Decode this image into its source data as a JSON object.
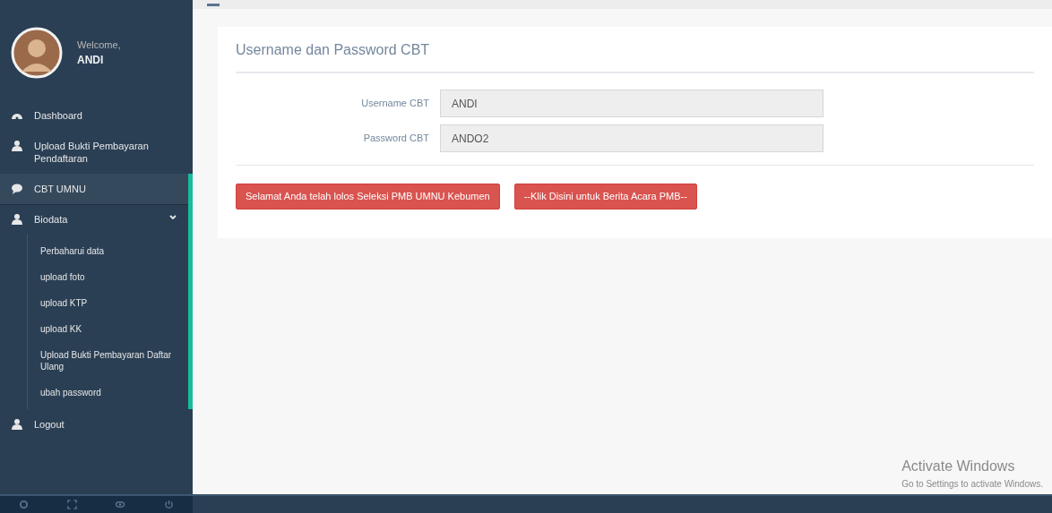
{
  "profile": {
    "greeting": "Welcome,",
    "name": "ANDI"
  },
  "menu": [
    {
      "kind": "link",
      "label": "Dashboard",
      "selected": false
    },
    {
      "kind": "link",
      "label": "Upload Bukti Pembayaran Pendaftaran",
      "selected": false
    },
    {
      "kind": "link",
      "label": "CBT UMNU",
      "selected": true
    },
    {
      "kind": "group",
      "label": "Biodata",
      "selected": false,
      "expanded": true,
      "children": [
        {
          "label": "Perbaharui data"
        },
        {
          "label": "upload foto"
        },
        {
          "label": "upload KTP"
        },
        {
          "label": "upload KK"
        },
        {
          "label": "Upload Bukti Pembayaran Daftar Ulang"
        },
        {
          "label": "ubah password"
        }
      ]
    },
    {
      "kind": "link",
      "label": "Logout",
      "selected": false
    }
  ],
  "panel": {
    "title": "Username dan Password CBT",
    "fields": [
      {
        "label": "Username CBT",
        "value": "ANDI"
      },
      {
        "label": "Password CBT",
        "value": "ANDO2"
      }
    ],
    "buttons": [
      "Selamat Anda telah lolos Seleksi PMB UMNU Kebumen",
      "--Klik Disini untuk Berita Acara PMB--"
    ]
  },
  "watermark": {
    "title": "Activate Windows",
    "subtitle": "Go to Settings to activate Windows."
  }
}
